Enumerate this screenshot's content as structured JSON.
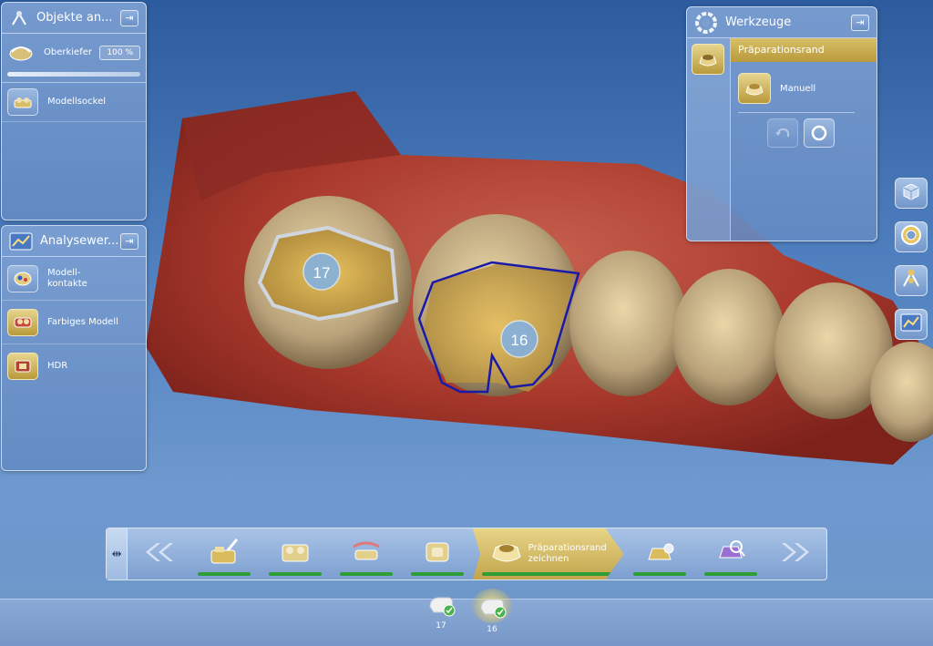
{
  "objects_panel": {
    "title": "Objekte an...",
    "pin_symbol": "⇥",
    "jaw": {
      "label": "Oberkiefer",
      "opacity": "100 %"
    },
    "items": [
      {
        "label": "Modellsockel",
        "icon": "model-base-icon"
      }
    ]
  },
  "analysis_panel": {
    "title": "Analysewer...",
    "pin_symbol": "⇥",
    "items": [
      {
        "label": "Modell-\nkontakte",
        "icon": "model-contacts-icon"
      },
      {
        "label": "Farbiges Modell",
        "icon": "colored-model-icon"
      },
      {
        "label": "HDR",
        "icon": "hdr-icon"
      }
    ]
  },
  "tools_panel": {
    "title": "Werkzeuge",
    "pin_symbol": "⇥",
    "section": "Präparationsrand",
    "tool": "Manuell",
    "undo_icon": "undo-icon",
    "reset_icon": "reset-icon"
  },
  "scene": {
    "tooth_labels": [
      "17",
      "16"
    ],
    "margin_line_color": "#1a1aa8"
  },
  "workflow": {
    "collapse_symbol": "⇹",
    "back_symbol": "«",
    "forward_symbol": "»",
    "active_step": "Präparationsrand\nzeichnen",
    "progress_color": "#2e9e35"
  },
  "teeth": [
    {
      "number": "17",
      "active": false
    },
    {
      "number": "16",
      "active": true
    }
  ],
  "colors": {
    "accent_gold": "#c2a54c",
    "panel_blue": "#7d9fd0",
    "background": "#4f7fbe"
  }
}
